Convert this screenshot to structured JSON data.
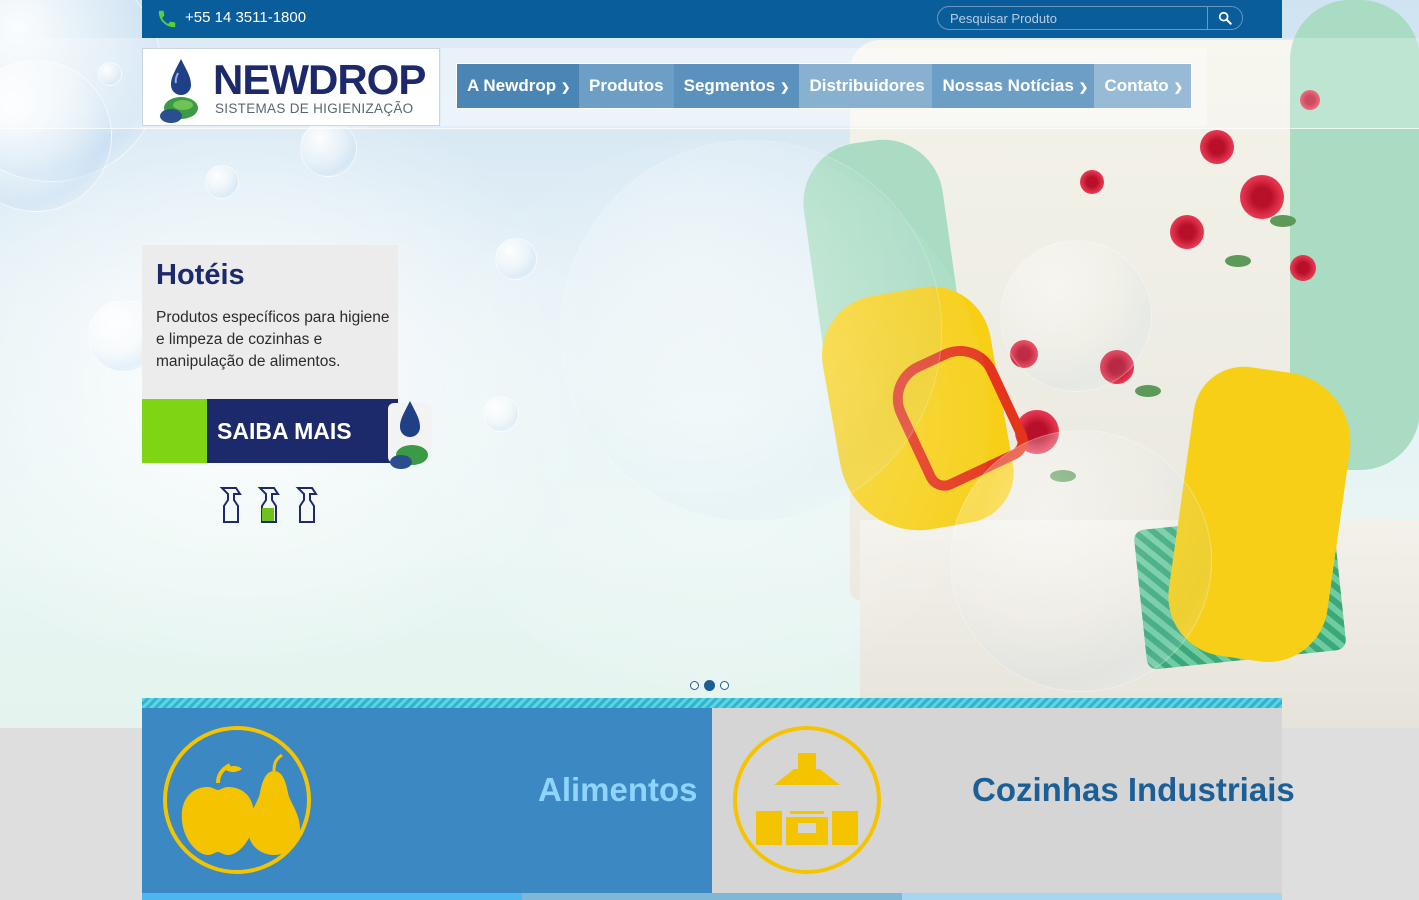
{
  "topbar": {
    "phone": "+55 14 3511-1800",
    "search_placeholder": "Pesquisar Produto"
  },
  "logo": {
    "title": "NEWDROP",
    "subtitle": "SISTEMAS DE HIGIENIZAÇÃO"
  },
  "nav": [
    {
      "label": "A Newdrop",
      "has_dropdown": true
    },
    {
      "label": "Produtos",
      "has_dropdown": false
    },
    {
      "label": "Segmentos",
      "has_dropdown": true
    },
    {
      "label": "Distribuidores",
      "has_dropdown": false
    },
    {
      "label": "Nossas Notícias",
      "has_dropdown": true
    },
    {
      "label": "Contato",
      "has_dropdown": true
    }
  ],
  "slide": {
    "title": "Hotéis",
    "text": "Produtos específicos para higiene e limpeza de cozinhas e manipulação de alimentos.",
    "button": "SAIBA MAIS",
    "active_index": 1,
    "count": 3
  },
  "segments": [
    {
      "label": "Alimentos",
      "icon": "fruit-icon"
    },
    {
      "label": "Cozinhas Industriais",
      "icon": "kitchen-icon"
    }
  ],
  "colors": {
    "primary": "#0a5d9b",
    "navy": "#1c2a6b",
    "green": "#7fd414",
    "yellow": "#f5c400",
    "segment_blue": "#3b88c3"
  }
}
